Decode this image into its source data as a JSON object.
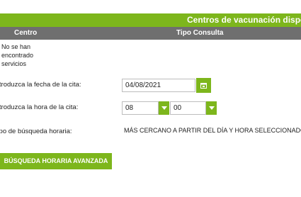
{
  "panel_title": "Centros de vacunación disponibles",
  "table": {
    "columns": [
      "Centro",
      "Tipo Consulta"
    ],
    "empty_message": "No se han encontrado servicios"
  },
  "form": {
    "date_label": "Introduzca la fecha de la cita:",
    "date_value": "04/08/2021",
    "time_label": "Introduzca la hora de la cita:",
    "hour_value": "08",
    "minute_value": "00",
    "search_type_label": "Tipo de búsqueda horaria:",
    "search_type_value": "MÁS CERCANO A PARTIR DEL DÍA Y HORA SELECCIONADOS",
    "advanced_button": "BÚSQUEDA HORARIA AVANZADA"
  },
  "colors": {
    "accent_green": "#7db61c",
    "header_gray": "#6f6f6f"
  },
  "icons": {
    "calendar": "calendar-icon",
    "dropdown": "chevron-down-icon"
  }
}
